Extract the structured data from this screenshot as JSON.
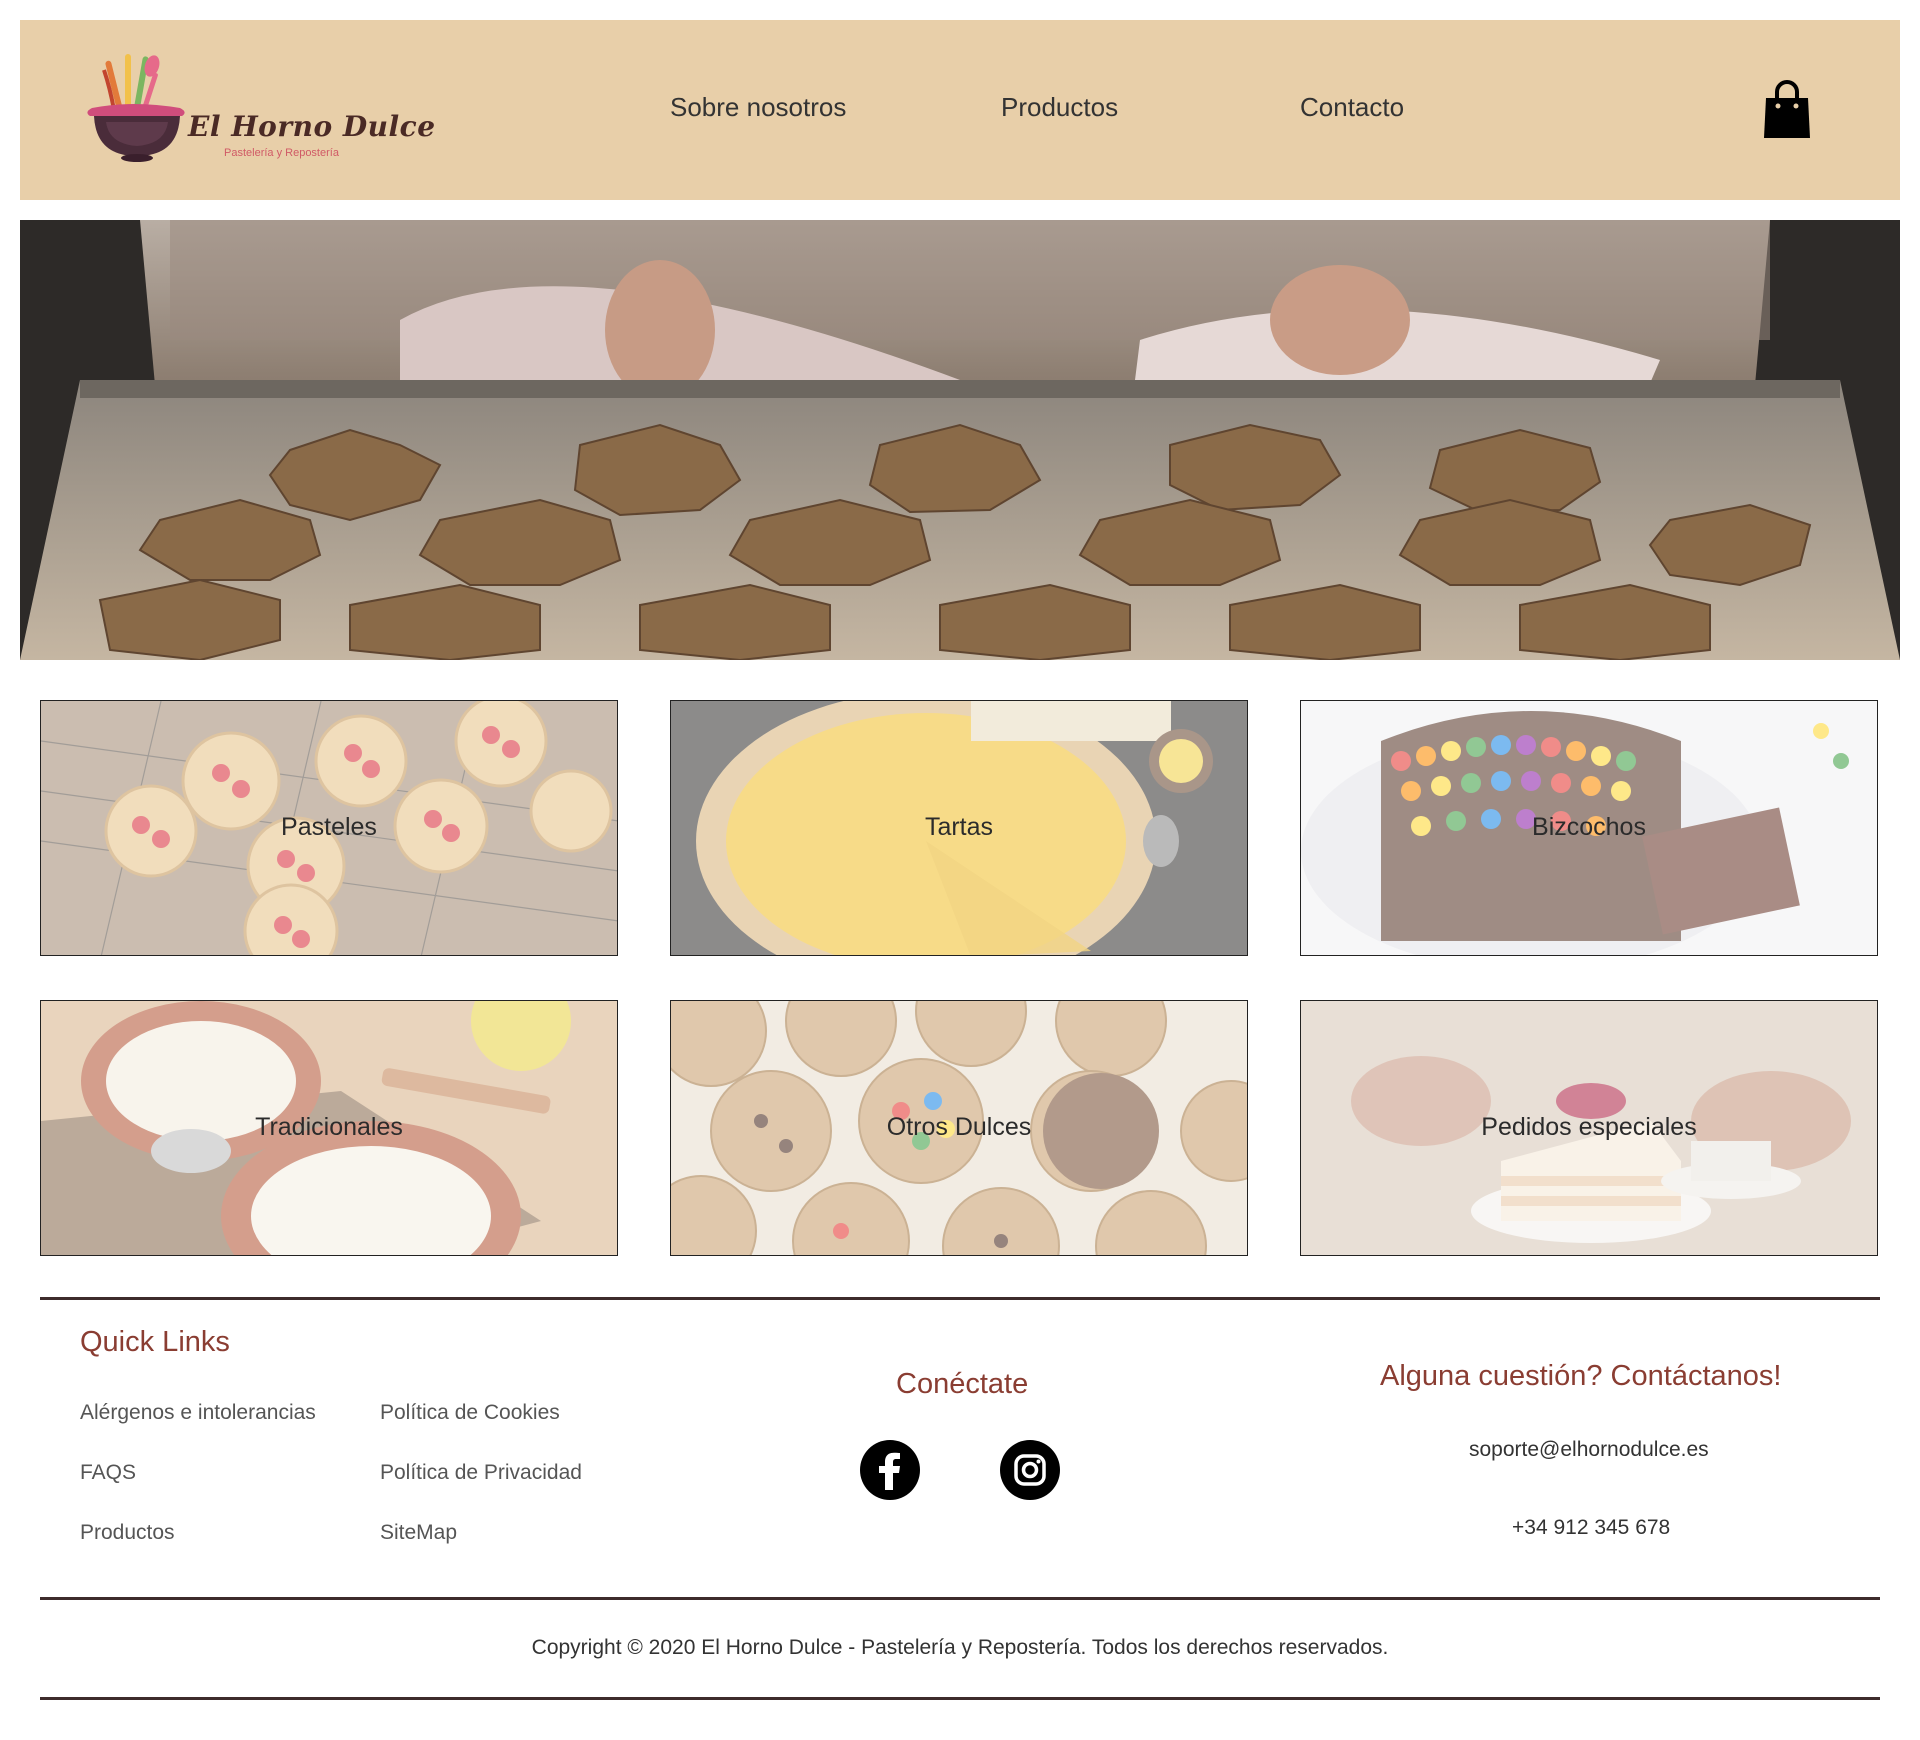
{
  "brand": {
    "name": "El Horno Dulce",
    "tagline": "Pastelería y Repostería"
  },
  "nav": {
    "items": [
      {
        "label": "Sobre nosotros"
      },
      {
        "label": "Productos"
      },
      {
        "label": "Contacto"
      }
    ],
    "cart_icon": "shopping-bag-icon"
  },
  "hero": {
    "image": "baking-tray-with-star-cookies"
  },
  "categories": [
    {
      "label": "Pasteles"
    },
    {
      "label": "Tartas"
    },
    {
      "label": "Bizcochos"
    },
    {
      "label": "Tradicionales"
    },
    {
      "label": "Otros Dulces"
    },
    {
      "label": "Pedidos especiales"
    }
  ],
  "footer": {
    "quick_links": {
      "title": "Quick Links",
      "items": [
        {
          "label": "Alérgenos e intolerancias"
        },
        {
          "label": "FAQS"
        },
        {
          "label": "Productos"
        },
        {
          "label": "Política de Cookies"
        },
        {
          "label": "Política de Privacidad"
        },
        {
          "label": "SiteMap"
        }
      ]
    },
    "social": {
      "title": "Conéctate",
      "icons": [
        "facebook-icon",
        "instagram-icon"
      ]
    },
    "contact": {
      "title": "Alguna cuestión? Contáctanos!",
      "email": "soporte@elhornodulce.es",
      "phone": "+34 912 345 678"
    },
    "copyright": "Copyright © 2020 El Horno Dulce - Pastelería y Repostería. Todos los derechos reservados."
  },
  "colors": {
    "header_bg": "#e8cfa9",
    "heading": "#8a3d32",
    "rule": "#3d2b2b"
  }
}
